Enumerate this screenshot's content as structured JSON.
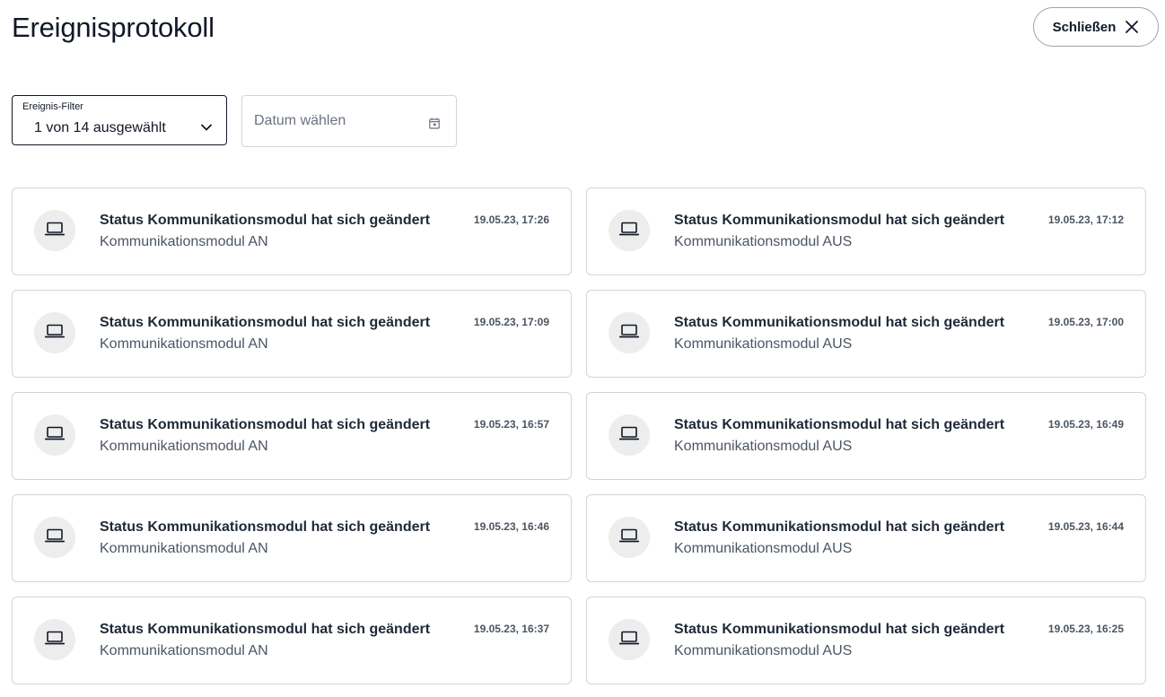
{
  "header": {
    "title": "Ereignisprotokoll",
    "close_label": "Schließen"
  },
  "filters": {
    "event_filter_label": "Ereignis-Filter",
    "event_filter_value": "1 von 14 ausgewählt",
    "date_placeholder": "Datum wählen"
  },
  "icons": {
    "event": "laptop-icon",
    "close": "close-icon",
    "dropdown": "chevron-down-icon",
    "date": "calendar-icon"
  },
  "events": [
    {
      "title": "Status Kommunikationsmodul hat sich geändert",
      "detail": "Kommunikationsmodul AN",
      "time": "19.05.23, 17:26"
    },
    {
      "title": "Status Kommunikationsmodul hat sich geändert",
      "detail": "Kommunikationsmodul AUS",
      "time": "19.05.23, 17:12"
    },
    {
      "title": "Status Kommunikationsmodul hat sich geändert",
      "detail": "Kommunikationsmodul AN",
      "time": "19.05.23, 17:09"
    },
    {
      "title": "Status Kommunikationsmodul hat sich geändert",
      "detail": "Kommunikationsmodul AUS",
      "time": "19.05.23, 17:00"
    },
    {
      "title": "Status Kommunikationsmodul hat sich geändert",
      "detail": "Kommunikationsmodul AN",
      "time": "19.05.23, 16:57"
    },
    {
      "title": "Status Kommunikationsmodul hat sich geändert",
      "detail": "Kommunikationsmodul AUS",
      "time": "19.05.23, 16:49"
    },
    {
      "title": "Status Kommunikationsmodul hat sich geändert",
      "detail": "Kommunikationsmodul AN",
      "time": "19.05.23, 16:46"
    },
    {
      "title": "Status Kommunikationsmodul hat sich geändert",
      "detail": "Kommunikationsmodul AUS",
      "time": "19.05.23, 16:44"
    },
    {
      "title": "Status Kommunikationsmodul hat sich geändert",
      "detail": "Kommunikationsmodul AN",
      "time": "19.05.23, 16:37"
    },
    {
      "title": "Status Kommunikationsmodul hat sich geändert",
      "detail": "Kommunikationsmodul AUS",
      "time": "19.05.23, 16:25"
    }
  ]
}
